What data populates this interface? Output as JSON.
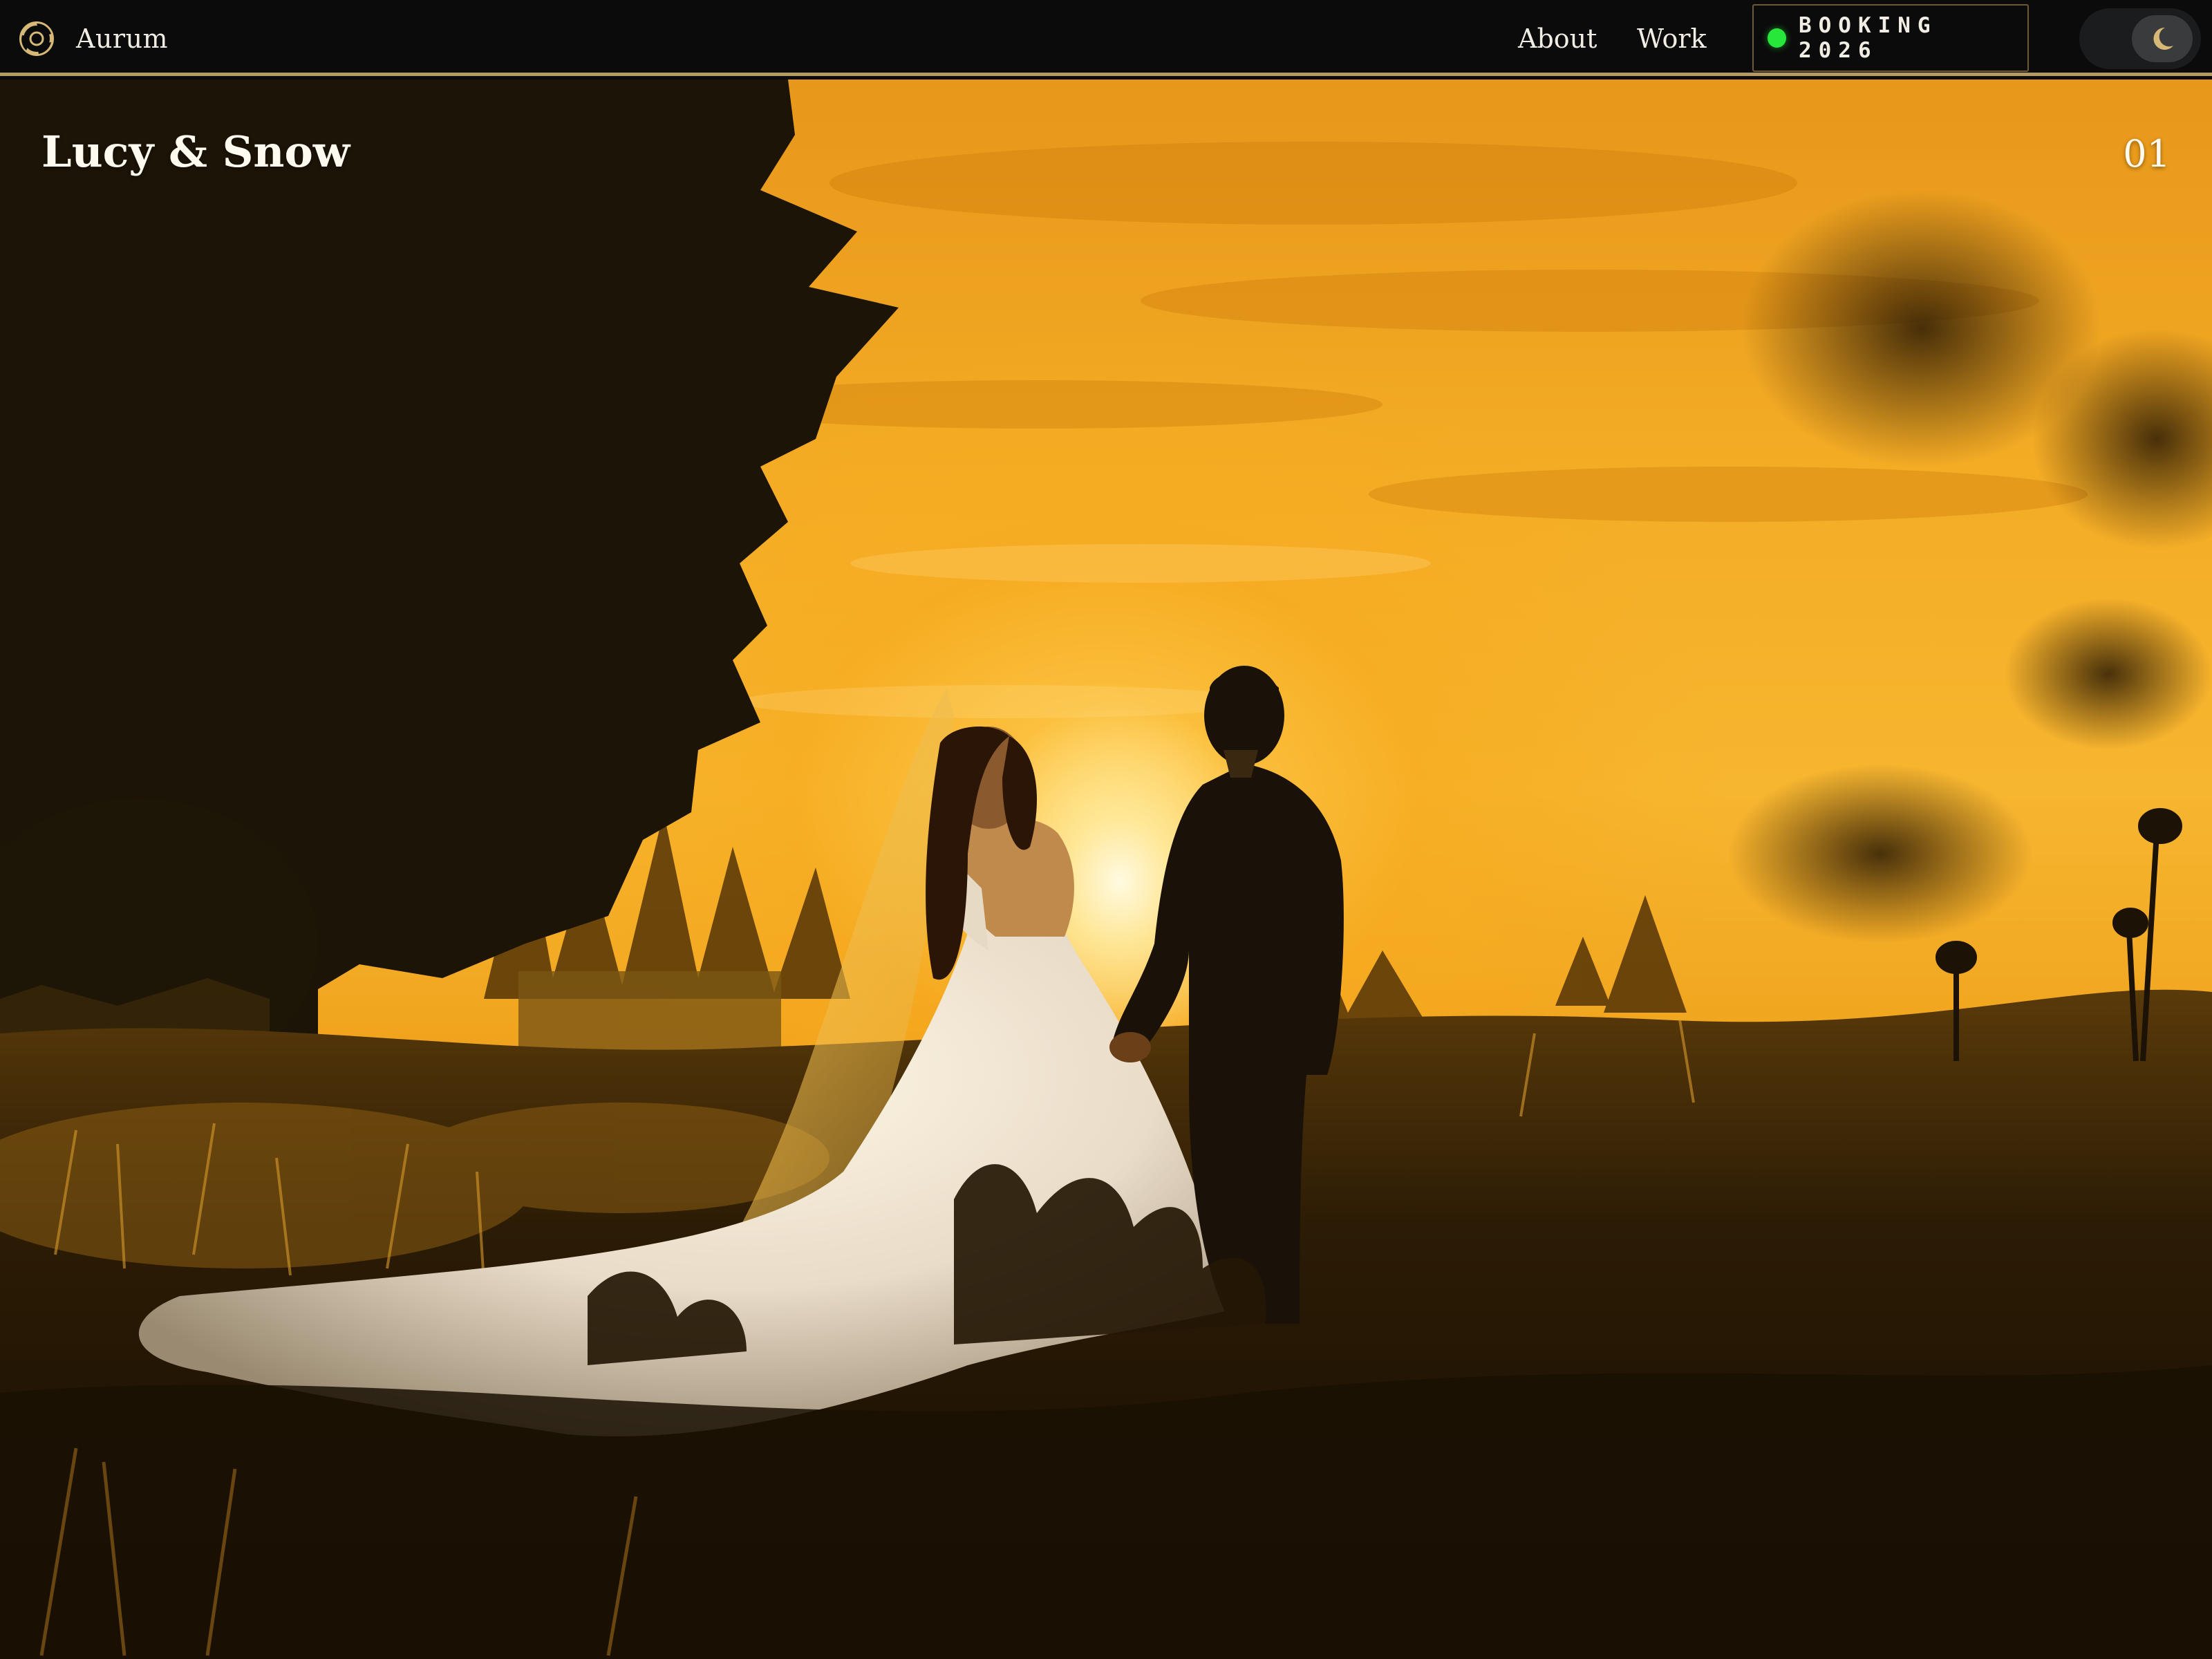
{
  "header": {
    "brand": {
      "name": "Aurum",
      "logo_icon": "aperture-logo-icon"
    },
    "nav": [
      {
        "label": "About"
      },
      {
        "label": "Work"
      }
    ],
    "booking": {
      "label": "BOOKING 2026",
      "status_color": "#27e83a"
    },
    "theme_toggle": {
      "icon": "moon-icon",
      "mode": "dark"
    },
    "accent_color": "#b59a62"
  },
  "hero": {
    "title": "Lucy & Snow",
    "index": "01"
  }
}
